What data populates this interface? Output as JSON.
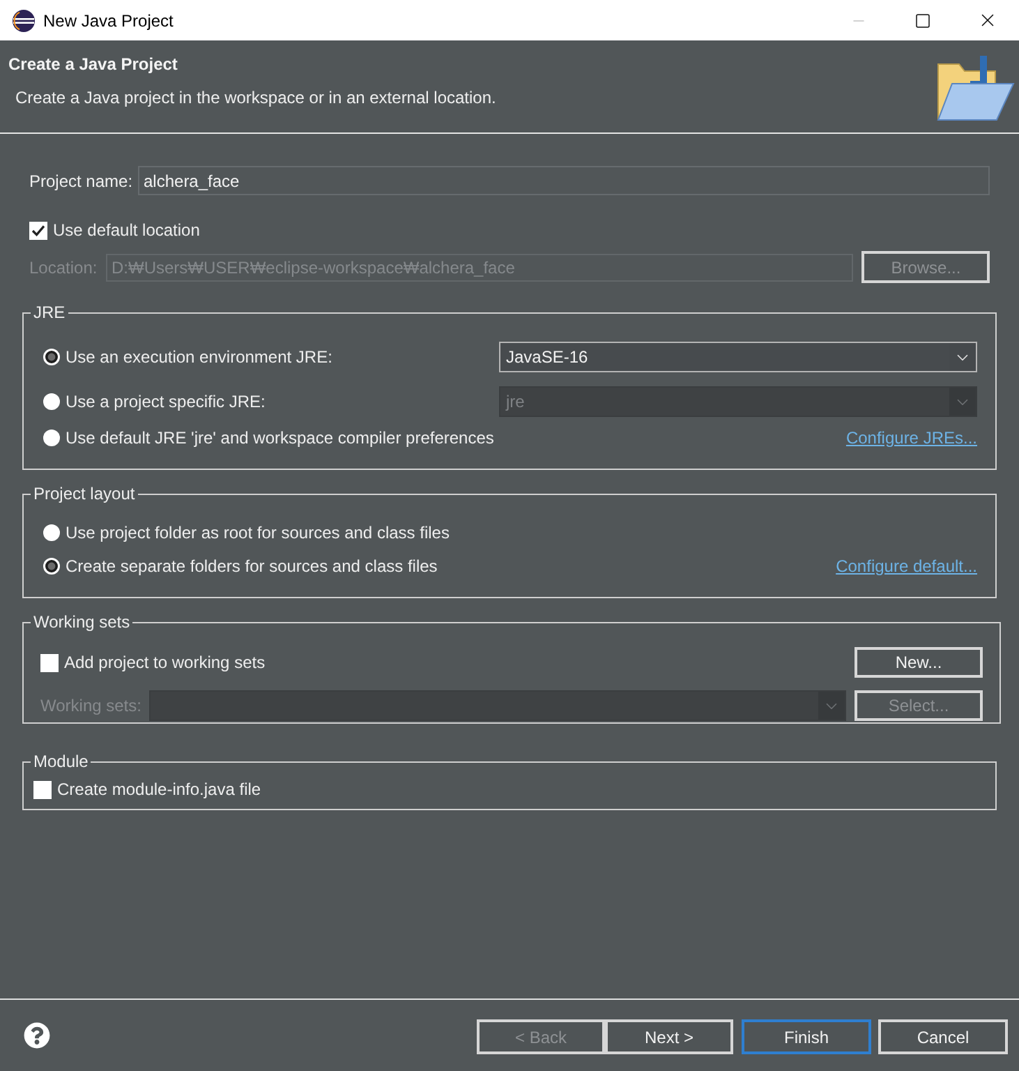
{
  "window": {
    "title": "New Java Project",
    "controls": [
      {
        "kind": "minimize",
        "disabled": true
      },
      {
        "kind": "maximize",
        "disabled": false
      },
      {
        "kind": "close",
        "disabled": false
      }
    ]
  },
  "header": {
    "title": "Create a Java Project",
    "description": "Create a Java project in the workspace or in an external location."
  },
  "project_name": {
    "label": "Project name:",
    "value": "alchera_face"
  },
  "default_location": {
    "label": "Use default location",
    "checked": true
  },
  "location": {
    "label": "Location:",
    "value": "D:₩Users₩USER₩eclipse-workspace₩alchera_face",
    "disabled": true
  },
  "browse_button": {
    "label": "Browse...",
    "disabled": true
  },
  "jre": {
    "title": "JRE",
    "options": [
      {
        "label": "Use an execution environment JRE:",
        "selected": true,
        "combo": {
          "value": "JavaSE-16",
          "disabled": false
        }
      },
      {
        "label": "Use a project specific JRE:",
        "selected": false,
        "combo": {
          "value": "jre",
          "disabled": true
        }
      },
      {
        "label": "Use default JRE 'jre' and workspace compiler preferences",
        "selected": false,
        "link": "Configure JREs..."
      }
    ]
  },
  "project_layout": {
    "title": "Project layout",
    "options": [
      {
        "label": "Use project folder as root for sources and class files",
        "selected": false
      },
      {
        "label": "Create separate folders for sources and class files",
        "selected": true,
        "link": "Configure default..."
      }
    ]
  },
  "working_sets": {
    "title": "Working sets",
    "add": {
      "label": "Add project to working sets",
      "checked": false
    },
    "new_button": {
      "label": "New...",
      "disabled": false
    },
    "sets": {
      "label": "Working sets:",
      "disabled": true
    },
    "select_button": {
      "label": "Select...",
      "disabled": true
    }
  },
  "module": {
    "title": "Module",
    "create": {
      "label": "Create module-info.java file",
      "checked": false
    }
  },
  "buttons": [
    {
      "label": "< Back",
      "disabled": true,
      "default": false
    },
    {
      "label": "Next >",
      "disabled": false,
      "default": false
    },
    {
      "label": "Finish",
      "disabled": false,
      "default": true
    },
    {
      "label": "Cancel",
      "disabled": false,
      "default": false
    }
  ]
}
